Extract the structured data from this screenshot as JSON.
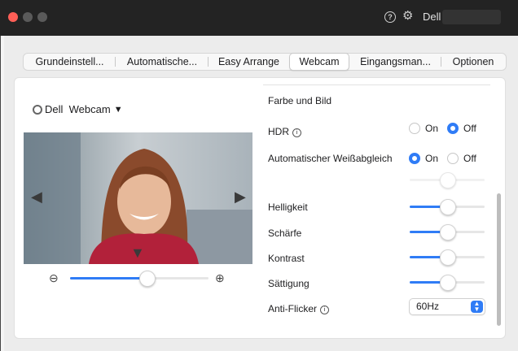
{
  "titlebar": {
    "brand": "Dell"
  },
  "tabs": [
    {
      "label": "Grundeinstell..."
    },
    {
      "label": "Automatische..."
    },
    {
      "label": "Easy Arrange"
    },
    {
      "label": "Webcam"
    },
    {
      "label": "Eingangsman..."
    },
    {
      "label": "Optionen"
    }
  ],
  "active_tab": "Webcam",
  "camera": {
    "selector_label": "Dell  Webcam"
  },
  "zoom": {
    "level": 0.55
  },
  "settings": {
    "section_title": "Farbe und Bild",
    "hdr": {
      "label": "HDR",
      "on_label": "On",
      "off_label": "Off",
      "selected": "Off"
    },
    "awb": {
      "label": "Automatischer Weißabgleich",
      "on_label": "On",
      "off_label": "Off",
      "selected": "On",
      "level": 0.5
    },
    "brightness": {
      "label": "Helligkeit",
      "level": 0.5
    },
    "sharpness": {
      "label": "Schärfe",
      "level": 0.5
    },
    "contrast": {
      "label": "Kontrast",
      "level": 0.5
    },
    "saturation": {
      "label": "Sättigung",
      "level": 0.5
    },
    "anti_flicker": {
      "label": "Anti-Flicker",
      "value": "60Hz"
    }
  },
  "colors": {
    "accent": "#2f7cf6",
    "titlebar": "#232323",
    "close": "#ff5f57"
  }
}
